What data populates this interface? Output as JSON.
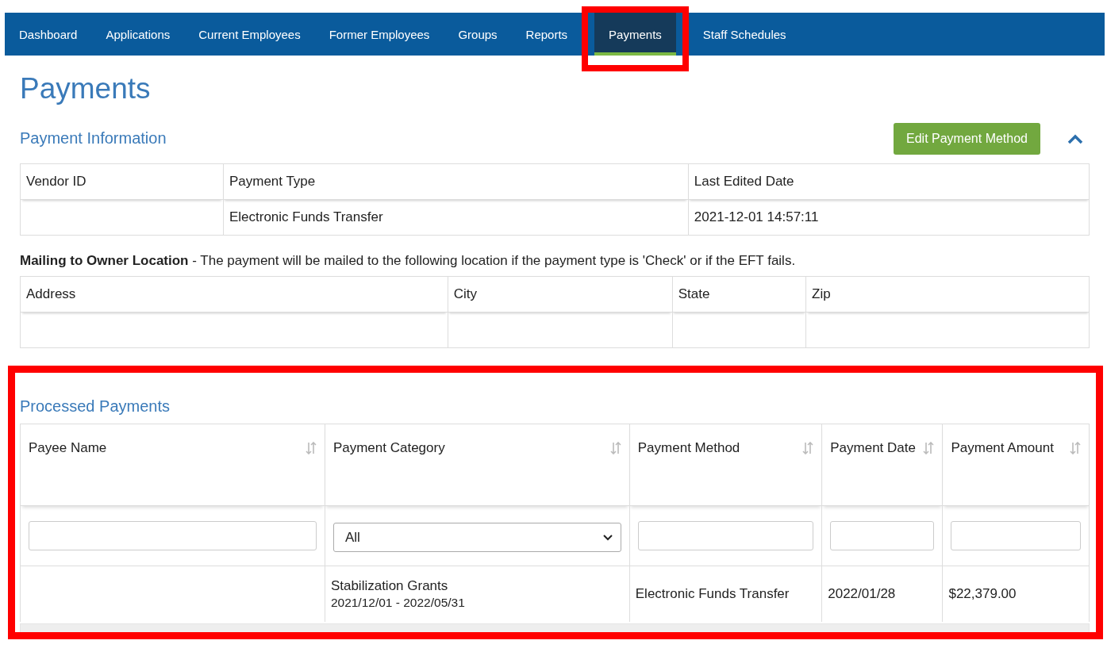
{
  "nav": [
    {
      "label": "Dashboard",
      "selected": false,
      "highlighted": false
    },
    {
      "label": "Applications",
      "selected": false,
      "highlighted": false
    },
    {
      "label": "Current Employees",
      "selected": false,
      "highlighted": false
    },
    {
      "label": "Former Employees",
      "selected": false,
      "highlighted": false
    },
    {
      "label": "Groups",
      "selected": false,
      "highlighted": false
    },
    {
      "label": "Reports",
      "selected": false,
      "highlighted": false
    },
    {
      "label": "Payments",
      "selected": true,
      "highlighted": true
    },
    {
      "label": "Staff Schedules",
      "selected": false,
      "highlighted": false
    }
  ],
  "page_title": "Payments",
  "payment_information": {
    "title": "Payment Information",
    "edit_button": "Edit Payment Method",
    "expanded": true,
    "columns": [
      "Vendor ID",
      "Payment Type",
      "Last Edited Date"
    ],
    "rows": [
      [
        "",
        "Electronic Funds Transfer",
        "2021-12-01 14:57:11"
      ]
    ]
  },
  "mailing": {
    "note": "**Mailing to Owner Location** - The payment will be mailed to the following location if the payment type is 'Check' or if the EFT fails.",
    "columns": [
      "Address",
      "City",
      "State",
      "Zip"
    ],
    "rows": [
      [
        "",
        "",
        "",
        ""
      ]
    ]
  },
  "processed_payments": {
    "title": "Processed Payments",
    "highlighted": true,
    "columns": [
      {
        "label": "Payee Name",
        "kind": "text"
      },
      {
        "label": "Payment Category",
        "kind": "select",
        "value": "All"
      },
      {
        "label": "Payment Method",
        "kind": "text"
      },
      {
        "label": "Payment Date",
        "kind": "text"
      },
      {
        "label": "Payment Amount",
        "kind": "text"
      }
    ],
    "rows": [
      {
        "payee": "",
        "category": "Stabilization Grants",
        "period": "2021/12/01 - 2022/05/31",
        "method": "Electronic Funds Transfer",
        "date": "2022/01/28",
        "amount": "$22,379.00"
      }
    ]
  }
}
